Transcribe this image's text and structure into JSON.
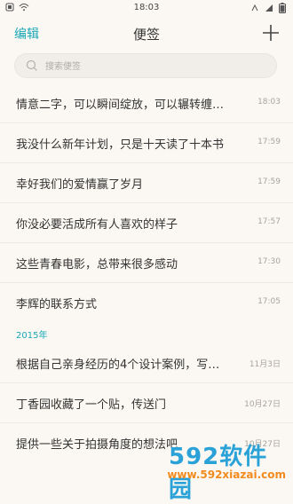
{
  "status_bar": {
    "time": "18:03"
  },
  "nav": {
    "edit_label": "编辑",
    "title": "便签"
  },
  "search": {
    "placeholder": "搜索便签"
  },
  "notes": [
    {
      "title": "情意二字，可以瞬间绽放，可以辗转缠…",
      "time": "18:03"
    },
    {
      "title": "我没什么新年计划，只是十天读了十本书",
      "time": "17:59"
    },
    {
      "title": "幸好我们的爱情赢了岁月",
      "time": "17:59"
    },
    {
      "title": "你没必要活成所有人喜欢的样子",
      "time": "17:57"
    },
    {
      "title": "这些青春电影，总带来很多感动",
      "time": "17:30"
    },
    {
      "title": "李辉的联系方式",
      "time": "17:05"
    }
  ],
  "section_2015": {
    "label": "2015年"
  },
  "notes_2015": [
    {
      "title": "根据自己亲身经历的4个设计案例，写…",
      "time": "11月3日"
    },
    {
      "title": "丁香园收藏了一个贴，传送门",
      "time": "10月27日"
    },
    {
      "title": "提供一些关于拍摄角度的想法吧",
      "time": "10月27日"
    }
  ],
  "watermark": {
    "logo": "592软件园",
    "url": "www.592xiazai.com"
  },
  "colors": {
    "accent": "#1aa7b7",
    "background": "#fbf8f3"
  }
}
